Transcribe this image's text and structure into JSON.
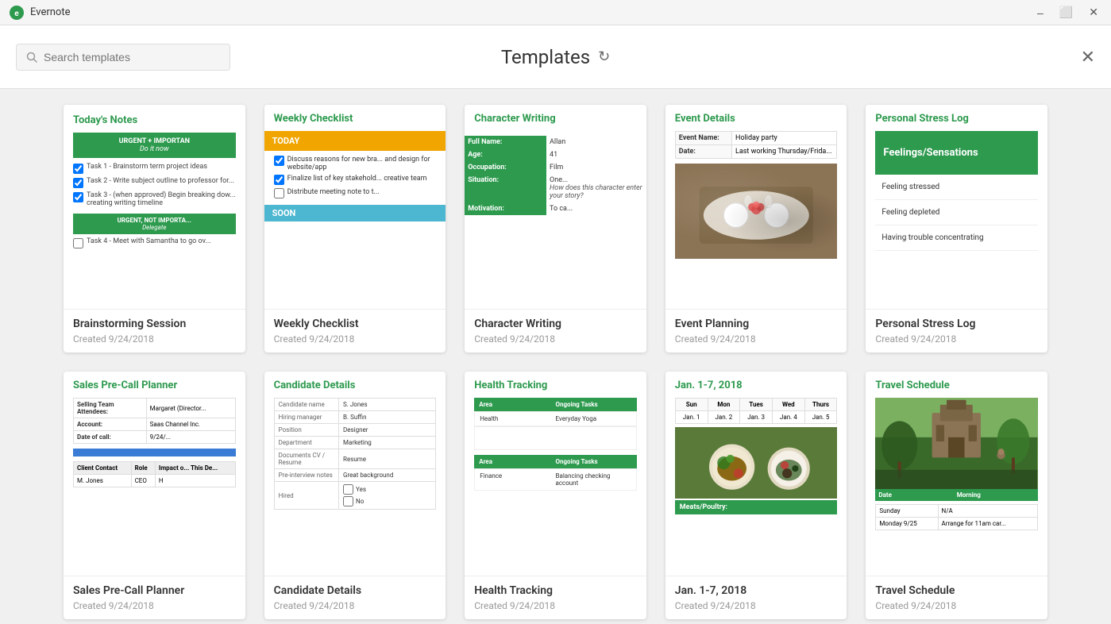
{
  "app": {
    "name": "Evernote"
  },
  "titlebar": {
    "minimize": "–",
    "maximize": "⬜",
    "close": "✕"
  },
  "header": {
    "search_placeholder": "Search templates",
    "title": "Templates",
    "close_label": "✕"
  },
  "cards": [
    {
      "title": "Brainstorming Session",
      "date": "Created 9/24/2018",
      "type": "brainstorming"
    },
    {
      "title": "Weekly Checklist",
      "date": "Created 9/24/2018",
      "type": "weekly-checklist"
    },
    {
      "title": "Character Writing",
      "date": "Created 9/24/2018",
      "type": "character-writing"
    },
    {
      "title": "Event Planning",
      "date": "Created 9/24/2018",
      "type": "event-planning"
    },
    {
      "title": "Personal Stress Log",
      "date": "Created 9/24/2018",
      "type": "personal-stress"
    },
    {
      "title": "Sales Pre-Call Planner",
      "date": "Created 9/24/2018",
      "type": "sales-pre-call"
    },
    {
      "title": "Candidate Details",
      "date": "Created 9/24/2018",
      "type": "candidate-details"
    },
    {
      "title": "Health Tracking",
      "date": "Created 9/24/2018",
      "type": "health-tracking"
    },
    {
      "title": "Jan. 1-7, 2018",
      "date": "Created 9/24/2018",
      "type": "weekly-calendar"
    },
    {
      "title": "Travel Schedule",
      "date": "Created 9/24/2018",
      "type": "travel-schedule"
    }
  ],
  "preview": {
    "brainstorming": {
      "heading": "Today's Notes",
      "urgent_label": "URGENT + IMPORTANT",
      "urgent_sub": "Do it now",
      "tasks": [
        "Task 1 - Brainstorm term project ideas",
        "Task 2 - Write subject outline to professor for...",
        "Task 3 - (when approved) Begin breaking dow... creating writing timeline"
      ],
      "urgent2_label": "URGENT, NOT IMPORTA...",
      "urgent2_sub": "Delegate"
    },
    "weekly_checklist": {
      "heading": "Weekly Checklist",
      "today": "TODAY",
      "tasks_checked": [
        "Discuss reasons for new bra... and design for website/app",
        "Finalize list of key stakehold... creative team"
      ],
      "tasks_unchecked": [
        "Distribute meeting note to t..."
      ],
      "soon": "SOON"
    },
    "character_writing": {
      "heading": "Character Writing",
      "fields": [
        {
          "label": "Full Name:",
          "value": "Allan"
        },
        {
          "label": "Age:",
          "value": "41"
        },
        {
          "label": "Occupation:",
          "value": "Film"
        },
        {
          "label": "Situation:",
          "value": "One...",
          "italic": "How does this character enter your story?"
        },
        {
          "label": "Motivation:",
          "value": "To ca..."
        }
      ]
    },
    "event_planning": {
      "heading": "Event Details",
      "fields": [
        {
          "label": "Event Name:",
          "value": "Holiday party"
        },
        {
          "label": "Date:",
          "value": "Last working Thursday/Frida..."
        }
      ]
    },
    "personal_stress": {
      "heading": "Personal Stress Log",
      "bar_label": "Feelings/Sensations",
      "items": [
        "Feeling stressed",
        "Feeling depleted",
        "Having trouble concentrating"
      ]
    },
    "sales_pre_call": {
      "heading": "Sales Pre-Call Planner",
      "fields": [
        {
          "label": "Selling Team Attendees:",
          "value": "Margaret (Director..."
        },
        {
          "label": "Account:",
          "value": "Saas Channel Inc."
        },
        {
          "label": "Date of call:",
          "value": "9/24/..."
        }
      ],
      "table_headers": [
        "Client Contact",
        "Role",
        "Impact o... This De... (High, Me... m, Low)"
      ],
      "table_row": [
        "M. Jones",
        "CEO",
        "H"
      ]
    },
    "candidate_details": {
      "heading": "Candidate Details",
      "fields": [
        {
          "label": "Candidate name",
          "value": "S. Jones"
        },
        {
          "label": "Hiring manager",
          "value": "B. Suffin"
        },
        {
          "label": "Position",
          "value": "Designer"
        },
        {
          "label": "Department",
          "value": "Marketing"
        },
        {
          "label": "Documents CV / Resume",
          "value": "Resume"
        },
        {
          "label": "Pre-interview notes",
          "value": "Great background"
        },
        {
          "label": "Hired",
          "options": [
            "Yes",
            "No"
          ]
        }
      ]
    },
    "health_tracking": {
      "heading": "Health Tracking",
      "sections": [
        {
          "area": "Health",
          "task": "Everyday Yoga"
        },
        {
          "area": "Finance",
          "task": "Balancing checking account"
        }
      ]
    },
    "weekly_calendar": {
      "heading": "Jan. 1-7, 2018",
      "days": [
        "Sun",
        "Mon",
        "Tues",
        "Wed",
        "Thurs"
      ],
      "dates": [
        "Jan. 1",
        "Jan. 2",
        "Jan. 3",
        "Jan. 4",
        "Jan. 5"
      ],
      "meats_label": "Meats/Poultry:"
    },
    "travel_schedule": {
      "heading": "Travel Schedule",
      "table_cols": [
        "Date",
        "Morning"
      ],
      "rows": [
        {
          "date": "Sunday",
          "morning": "N/A"
        },
        {
          "date": "Monday 9/25",
          "morning": "Arrange for 11am car..."
        }
      ]
    }
  }
}
